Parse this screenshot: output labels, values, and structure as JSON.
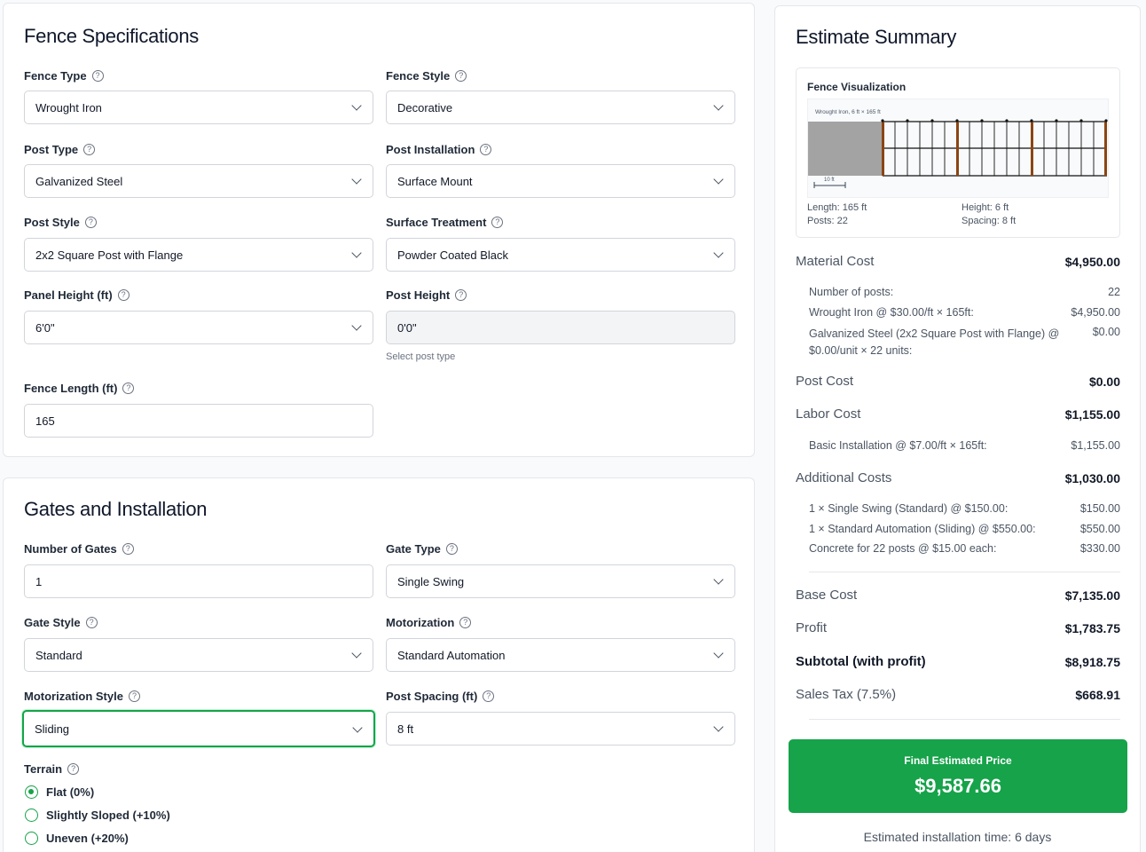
{
  "specs": {
    "title": "Fence Specifications",
    "fence_type": {
      "label": "Fence Type",
      "value": "Wrought Iron"
    },
    "fence_style": {
      "label": "Fence Style",
      "value": "Decorative"
    },
    "post_type": {
      "label": "Post Type",
      "value": "Galvanized Steel"
    },
    "post_installation": {
      "label": "Post Installation",
      "value": "Surface Mount"
    },
    "post_style": {
      "label": "Post Style",
      "value": "2x2 Square Post with Flange"
    },
    "surface_treatment": {
      "label": "Surface Treatment",
      "value": "Powder Coated Black"
    },
    "panel_height": {
      "label": "Panel Height (ft)",
      "value": "6'0\""
    },
    "post_height": {
      "label": "Post Height",
      "value": "0'0\"",
      "hint": "Select post type"
    },
    "fence_length": {
      "label": "Fence Length (ft)",
      "value": "165"
    }
  },
  "gates": {
    "title": "Gates and Installation",
    "number_of_gates": {
      "label": "Number of Gates",
      "value": "1"
    },
    "gate_type": {
      "label": "Gate Type",
      "value": "Single Swing"
    },
    "gate_style": {
      "label": "Gate Style",
      "value": "Standard"
    },
    "motorization": {
      "label": "Motorization",
      "value": "Standard Automation"
    },
    "motorization_style": {
      "label": "Motorization Style",
      "value": "Sliding"
    },
    "post_spacing": {
      "label": "Post Spacing (ft)",
      "value": "8 ft"
    },
    "terrain": {
      "label": "Terrain",
      "options": [
        {
          "label": "Flat (0%)",
          "checked": true
        },
        {
          "label": "Slightly Sloped (+10%)",
          "checked": false
        },
        {
          "label": "Uneven (+20%)",
          "checked": false
        }
      ]
    }
  },
  "summary": {
    "title": "Estimate Summary",
    "viz": {
      "title": "Fence Visualization",
      "caption": "Wrought Iron, 6 ft × 165 ft",
      "scale_label": "10 ft",
      "length": "Length: 165 ft",
      "height": "Height: 6 ft",
      "posts": "Posts: 22",
      "spacing": "Spacing: 8 ft"
    },
    "material": {
      "label": "Material Cost",
      "value": "$4,950.00"
    },
    "material_items": [
      {
        "label": "Number of posts:",
        "value": "22"
      },
      {
        "label": "Wrought Iron @ $30.00/ft × 165ft:",
        "value": "$4,950.00"
      },
      {
        "label": "Galvanized Steel (2x2 Square Post with Flange) @ $0.00/unit × 22 units:",
        "value": "$0.00"
      }
    ],
    "post": {
      "label": "Post Cost",
      "value": "$0.00"
    },
    "labor": {
      "label": "Labor Cost",
      "value": "$1,155.00"
    },
    "labor_items": [
      {
        "label": "Basic Installation @ $7.00/ft × 165ft:",
        "value": "$1,155.00"
      }
    ],
    "additional": {
      "label": "Additional Costs",
      "value": "$1,030.00"
    },
    "additional_items": [
      {
        "label": "1 × Single Swing (Standard) @ $150.00:",
        "value": "$150.00"
      },
      {
        "label": "1 × Standard Automation (Sliding) @ $550.00:",
        "value": "$550.00"
      },
      {
        "label": "Concrete for 22 posts @ $15.00 each:",
        "value": "$330.00"
      }
    ],
    "base": {
      "label": "Base Cost",
      "value": "$7,135.00"
    },
    "profit": {
      "label": "Profit",
      "value": "$1,783.75"
    },
    "subtotal": {
      "label": "Subtotal (with profit)",
      "value": "$8,918.75"
    },
    "tax": {
      "label": "Sales Tax (7.5%)",
      "value": "$668.91"
    },
    "final": {
      "label": "Final Estimated Price",
      "value": "$9,587.66"
    },
    "install_time": "Estimated installation time: 6 days"
  },
  "colors": {
    "accent": "#16a34a",
    "post": "#8b4513",
    "ground": "#a3a3a3"
  },
  "icons": {
    "help": "question-circle-icon",
    "dropdown": "chevron-down-icon"
  }
}
